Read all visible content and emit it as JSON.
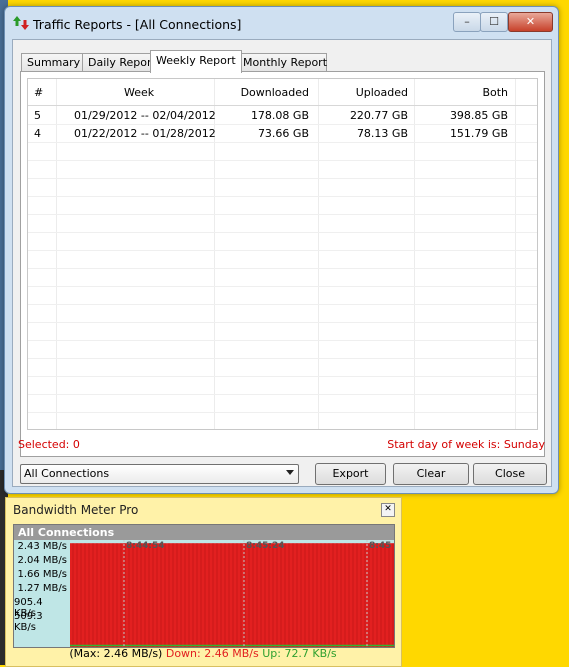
{
  "window": {
    "title": "Traffic Reports - [All Connections]",
    "controls": {
      "minimize": "–",
      "maximize": "☐",
      "close": "✕"
    }
  },
  "tabs": [
    {
      "label": "Summary",
      "active": false
    },
    {
      "label": "Daily Report",
      "active": false
    },
    {
      "label": "Weekly Report",
      "active": true
    },
    {
      "label": "Monthly Report",
      "active": false
    }
  ],
  "table": {
    "columns": [
      "#",
      "Week",
      "Downloaded",
      "Uploaded",
      "Both"
    ],
    "rows": [
      [
        "5",
        "01/29/2012 -- 02/04/2012",
        "178.08 GB",
        "220.77 GB",
        "398.85 GB"
      ],
      [
        "4",
        "01/22/2012 -- 01/28/2012",
        "73.66 GB",
        "78.13 GB",
        "151.79 GB"
      ]
    ]
  },
  "status": {
    "selected": "Selected: 0",
    "week_start": "Start day of week is: Sunday"
  },
  "controls": {
    "connection_select": "All Connections",
    "export": "Export",
    "clear": "Clear",
    "close": "Close"
  },
  "meter": {
    "title": "Bandwidth Meter Pro",
    "close": "✕",
    "header": "All Connections",
    "y_labels": [
      "2.43 MB/s",
      "2.04 MB/s",
      "1.66 MB/s",
      "1.27 MB/s",
      "905.4 KB/s",
      "509.3 KB/s"
    ],
    "time_labels": [
      "8:44:54",
      "8:45:24",
      "8:45"
    ],
    "footer_max": "(Max: 2.46 MB/s)",
    "footer_down": "Down: 2.46 MB/s",
    "footer_up": "Up: 72.7 KB/s",
    "colors": {
      "down": "#e22020",
      "up": "#2fb52f",
      "header": "#9a9a9a",
      "bg": "#bfe6e6"
    },
    "fill_level": 0.97
  }
}
